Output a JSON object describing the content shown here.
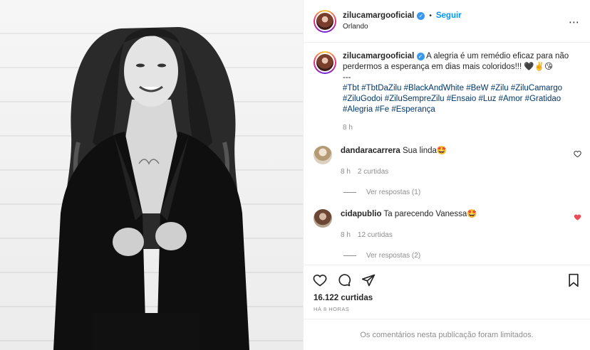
{
  "header": {
    "username": "zilucamargooficial",
    "separator": "•",
    "follow_label": "Seguir",
    "location": "Orlando",
    "more_label": "⋯"
  },
  "caption": {
    "username": "zilucamargooficial",
    "text": "A alegria é um remédio eficaz para não perdermos a esperança em dias mais coloridos!!! 🖤✌️😘",
    "separator": "---",
    "hashtags_line1": "#Tbt #TbtDaZilu #BlackAndWhite #BeW #Zilu #ZiluCamargo",
    "hashtags_line2": "#ZiluGodoi #ZiluSempreZilu #Ensaio #Luz #Amor #Gratidao",
    "hashtags_line3": "#Alegria #Fe #Esperança",
    "time": "8 h"
  },
  "comments": [
    {
      "username": "dandaracarrera",
      "text": "Sua linda🤩",
      "time": "8 h",
      "likes": "2 curtidas",
      "replies": "Ver respostas (1)",
      "liked": false
    },
    {
      "username": "cidapublio",
      "text": "Ta parecendo Vanessa🤩",
      "time": "8 h",
      "likes": "12 curtidas",
      "replies": "Ver respostas (2)",
      "liked": true
    }
  ],
  "footer": {
    "likes": "16.122 curtidas",
    "ago": "HÁ 8 HORAS",
    "limited": "Os comentários nesta publicação foram limitados."
  },
  "colors": {
    "link_blue": "#0095f6",
    "hashtag_blue": "#00376b",
    "heart_red": "#ed4956",
    "muted": "#8e8e8e"
  }
}
